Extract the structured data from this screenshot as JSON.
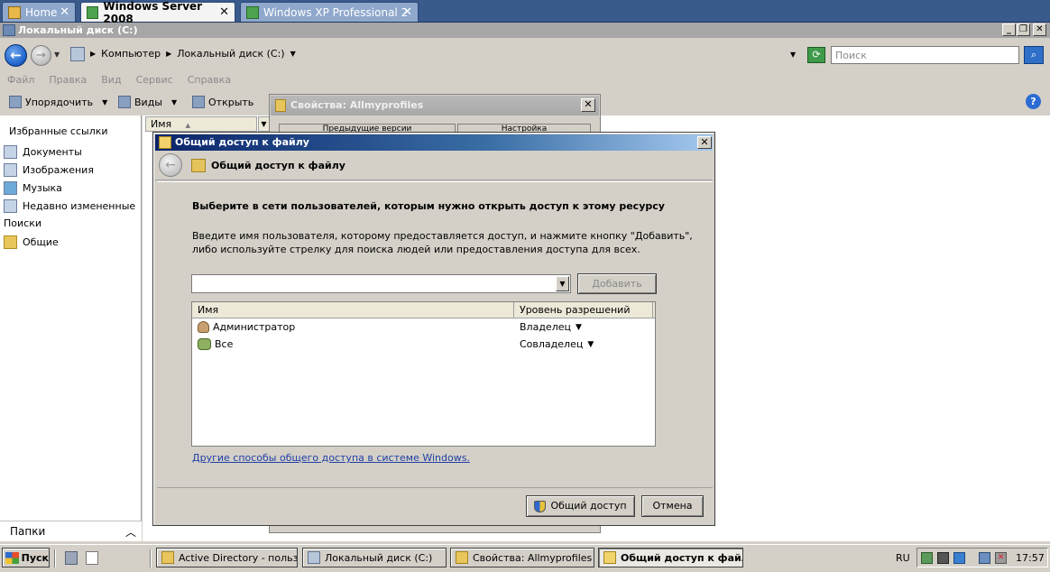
{
  "vm_tabs": [
    {
      "label": "Home",
      "active": false
    },
    {
      "label": "Windows Server 2008",
      "active": true
    },
    {
      "label": "Windows XP Professional 2",
      "active": false
    }
  ],
  "explorer": {
    "title": "Локальный диск (C:)",
    "breadcrumb": [
      "Компьютер",
      "Локальный диск (C:)"
    ],
    "search_placeholder": "Поиск",
    "menu": [
      "Файл",
      "Правка",
      "Вид",
      "Сервис",
      "Справка"
    ],
    "toolbar": {
      "organize": "Упорядочить",
      "views": "Виды",
      "open": "Открыть"
    },
    "favorites_title": "Избранные ссылки",
    "favorites": [
      "Документы",
      "Изображения",
      "Музыка",
      "Недавно измененные",
      "Поиски",
      "Общие"
    ],
    "folders_label": "Папки",
    "column_name": "Имя"
  },
  "properties_dialog": {
    "title": "Свойства: Allmyprofiles",
    "tab_left": "Предыдущие версии",
    "tab_right": "Настройка"
  },
  "share_dialog": {
    "title": "Общий доступ к файлу",
    "header": "Общий доступ к файлу",
    "heading": "Выберите в сети пользователей, которым нужно открыть доступ к этому ресурсу",
    "instructions": "Введите имя пользователя, которому предоставляется доступ, и нажмите кнопку \"Добавить\", либо используйте стрелку для поиска людей или предоставления доступа для всех.",
    "add_button": "Добавить",
    "columns": {
      "name": "Имя",
      "permission": "Уровень разрешений"
    },
    "rows": [
      {
        "name": "Администратор",
        "permission": "Владелец",
        "icon": "user-icon"
      },
      {
        "name": "Все",
        "permission": "Совладелец",
        "icon": "group-icon"
      }
    ],
    "link": "Другие способы общего доступа в системе Windows.",
    "share_button": "Общий доступ",
    "cancel_button": "Отмена"
  },
  "taskbar": {
    "start": "Пуск",
    "tasks": [
      {
        "label": "Active Directory - польз...",
        "active": false
      },
      {
        "label": "Локальный диск (C:)",
        "active": false
      },
      {
        "label": "Свойства: Allmyprofiles",
        "active": false
      },
      {
        "label": "Общий доступ к файлу",
        "active": true
      }
    ],
    "language": "RU",
    "clock": "17:57"
  },
  "colors": {
    "titlebar_start": "#0a246a",
    "titlebar_end": "#a6caf0",
    "link": "#1f3fa6",
    "face": "#d4d0c8"
  }
}
